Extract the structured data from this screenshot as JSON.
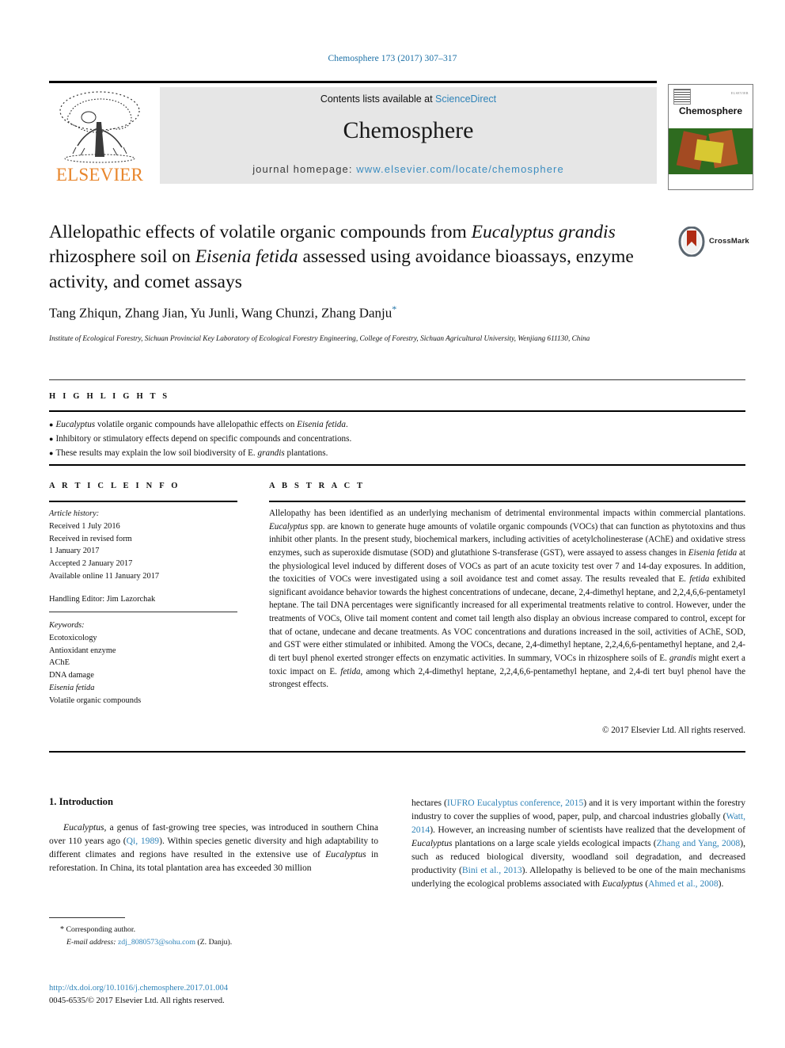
{
  "running_head": "Chemosphere 173 (2017) 307–317",
  "masthead": {
    "contents_text": "Contents lists available at ",
    "sciencedirect_link": "ScienceDirect",
    "journal_title": "Chemosphere",
    "homepage_label": "journal homepage: ",
    "homepage_link": "www.elsevier.com/locate/chemosphere",
    "publisher": "ELSEVIER",
    "cover_journal_name": "Chemosphere",
    "cover_tiny_text": "ELSEVIER"
  },
  "crossmark": {
    "label": "CrossMark"
  },
  "title": {
    "line1_a": "Allelopathic effects of volatile organic compounds from ",
    "line1_i": "Eucalyptus",
    "line2_i1": "grandis",
    "line2_a": " rhizosphere soil on ",
    "line2_i2": "Eisenia fetida",
    "line2_b": " assessed using avoidance",
    "line3": "bioassays, enzyme activity, and comet assays"
  },
  "authors": {
    "names": "Tang Zhiqun, Zhang Jian, Yu Junli, Wang Chunzi, Zhang Danju",
    "corresponding_marker": "*"
  },
  "affiliation": "Institute of Ecological Forestry, Sichuan Provincial Key Laboratory of Ecological Forestry Engineering, College of Forestry, Sichuan Agricultural University, Wenjiang 611130, China",
  "highlights": {
    "label": "H I G H L I G H T S",
    "bullet_glyph": "●",
    "items": [
      {
        "italic_lead": "Eucalyptus",
        "text_a": " volatile organic compounds have allelopathic effects on ",
        "italic_tail": "Eisenia fetida",
        "text_b": "."
      },
      {
        "italic_lead": "",
        "text_a": "Inhibitory or stimulatory effects depend on specific compounds and concentrations.",
        "italic_tail": "",
        "text_b": ""
      },
      {
        "italic_lead": "",
        "text_a": "These results may explain the low soil biodiversity of E. ",
        "italic_tail": "grandis",
        "text_b": " plantations."
      }
    ]
  },
  "article_info": {
    "label": "A R T I C L E   I N F O",
    "history_title": "Article history:",
    "received": "Received 1 July 2016",
    "revised_label": "Received in revised form",
    "revised_date": "1 January 2017",
    "accepted": "Accepted 2 January 2017",
    "available": "Available online 11 January 2017",
    "handling_editor": "Handling Editor: Jim Lazorchak",
    "keywords_title": "Keywords:",
    "keywords": [
      "Ecotoxicology",
      "Antioxidant enzyme",
      "AChE",
      "DNA damage",
      "Eisenia fetida",
      "Volatile organic compounds"
    ],
    "keyword_italic_index": 4
  },
  "abstract": {
    "label": "A B S T R A C T",
    "p1": "Allelopathy has been identified as an underlying mechanism of detrimental environmental impacts within commercial plantations. ",
    "i1": "Eucalyptus",
    "p2": " spp. are known to generate huge amounts of volatile organic compounds (VOCs) that can function as phytotoxins and thus inhibit other plants. In the present study, biochemical markers, including activities of acetylcholinesterase (AChE) and oxidative stress enzymes, such as superoxide dismutase (SOD) and glutathione S-transferase (GST), were assayed to assess changes in ",
    "i2": "Eisenia fetida",
    "p3": " at the physiological level induced by different doses of VOCs as part of an acute toxicity test over 7 and 14-day exposures. In addition, the toxicities of VOCs were investigated using a soil avoidance test and comet assay. The results revealed that E. ",
    "i3": "fetida",
    "p4": " exhibited significant avoidance behavior towards the highest concentrations of undecane, decane, 2,4-dimethyl heptane, and 2,2,4,6,6-pentametyl heptane. The tail DNA percentages were significantly increased for all experimental treatments relative to control. However, under the treatments of VOCs, Olive tail moment content and comet tail length also display an obvious increase compared to control, except for that of octane, undecane and decane treatments. As VOC concentrations and durations increased in the soil, activities of AChE, SOD, and GST were either stimulated or inhibited. Among the VOCs, decane, 2,4-dimethyl heptane, 2,2,4,6,6-pentamethyl heptane, and 2,4-di tert buyl phenol exerted stronger effects on enzymatic activities. In summary, VOCs in rhizosphere soils of E. ",
    "i4": "grandis",
    "p5": " might exert a toxic impact on E. ",
    "i5": "fetida",
    "p6": ", among which 2,4-dimethyl heptane, 2,2,4,6,6-pentamethyl heptane, and 2,4-di tert buyl phenol have the strongest effects.",
    "copyright": "© 2017 Elsevier Ltd. All rights reserved."
  },
  "introduction": {
    "heading": "1. Introduction",
    "left_p1_i1": "Eucalyptus",
    "left_p1_a": ", a genus of fast-growing tree species, was introduced in southern China over 110 years ago (",
    "left_p1_ref1": "Qi, 1989",
    "left_p1_b": "). Within species genetic diversity and high adaptability to different climates and regions have resulted in the extensive use of ",
    "left_p1_i2": "Eucalyptus",
    "left_p1_c": " in reforestation. In China, its total plantation area has exceeded 30 million",
    "right_a": "hectares (",
    "right_ref1": "IUFRO Eucalyptus conference, 2015",
    "right_b": ") and it is very important within the forestry industry to cover the supplies of wood, paper, pulp, and charcoal industries globally (",
    "right_ref2": "Watt, 2014",
    "right_c": "). However, an increasing number of scientists have realized that the development of ",
    "right_i1": "Eucalyptus",
    "right_d": " plantations on a large scale yields ecological impacts (",
    "right_ref3": "Zhang and Yang, 2008",
    "right_e": "), such as reduced biological diversity, woodland soil degradation, and decreased productivity (",
    "right_ref4": "Bini et al., 2013",
    "right_f": "). Allelopathy is believed to be one of the main mechanisms underlying the ecological problems associated with ",
    "right_i2": "Eucalyptus",
    "right_g": " (",
    "right_ref5": "Ahmed et al., 2008",
    "right_h": ")."
  },
  "footnote": {
    "star": "*",
    "corresponding": " Corresponding author.",
    "email_label": "E-mail address:",
    "email": "zdj_8080573@sohu.com",
    "email_suffix": " (Z. Danju)."
  },
  "footer": {
    "doi": "http://dx.doi.org/10.1016/j.chemosphere.2017.01.004",
    "issn_line": "0045-6535/© 2017 Elsevier Ltd. All rights reserved."
  },
  "colors": {
    "link_blue": "#2f83b8",
    "elsevier_orange": "#e8862c",
    "band_gray": "#e6e6e6"
  }
}
